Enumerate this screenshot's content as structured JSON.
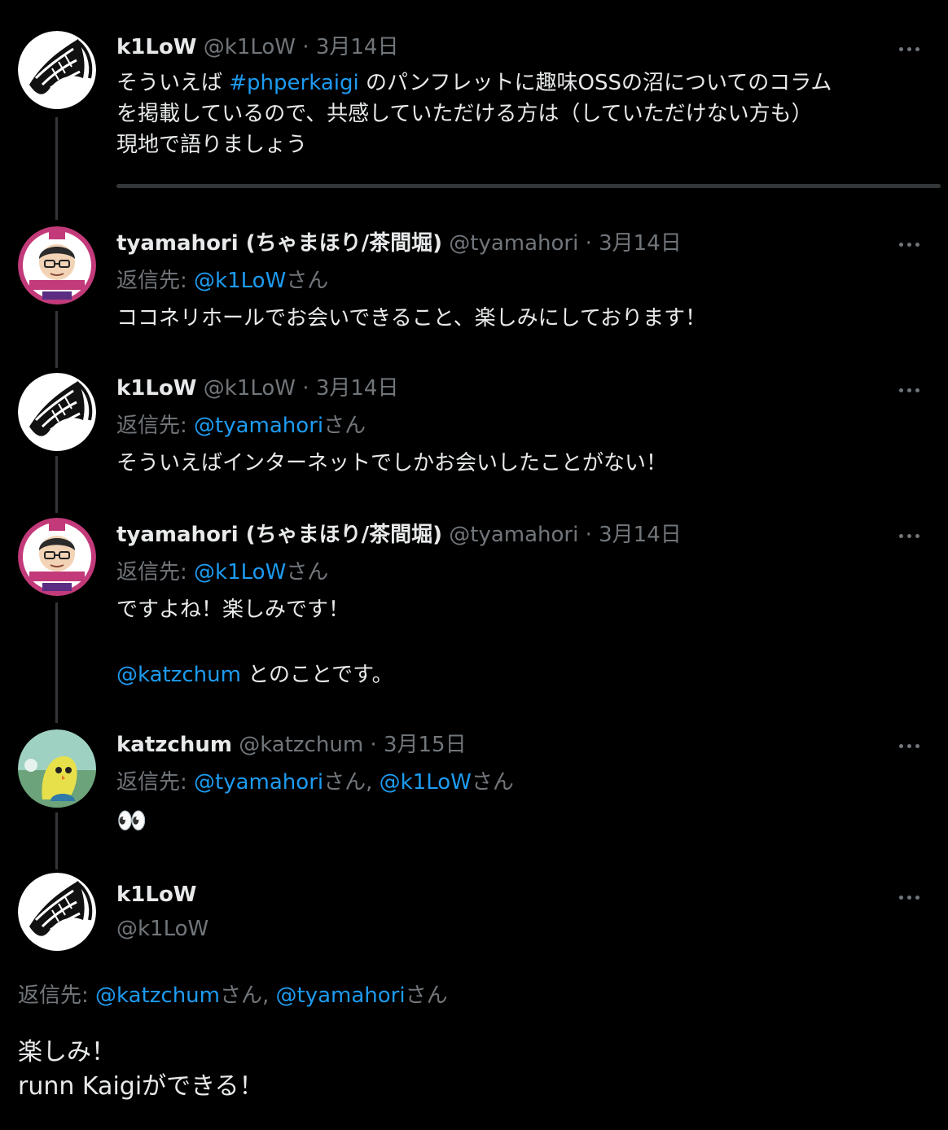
{
  "tweets": [
    {
      "name": "k1LoW",
      "handle": "@k1LoW",
      "sep": "·",
      "date": "3月14日",
      "text_pre": "そういえば ",
      "hashtag": "#phperkaigi",
      "text_post": " のパンフレットに趣味OSSの沼についてのコラム",
      "line2": "を掲載しているので、共感していただける方は（していただけない方も）",
      "line3": "現地で語りましょう"
    },
    {
      "name": "tyamahori (ちゃまほり/茶間堀)",
      "handle": "@tyamahori",
      "sep": "·",
      "date": "3月14日",
      "reply_label": "返信先: ",
      "reply_to": "@k1LoW",
      "reply_suffix": "さん",
      "text": "ココネリホールでお会いできること、楽しみにしております！"
    },
    {
      "name": "k1LoW",
      "handle": "@k1LoW",
      "sep": "·",
      "date": "3月14日",
      "reply_label": "返信先: ",
      "reply_to": "@tyamahori",
      "reply_suffix": "さん",
      "text": "そういえばインターネットでしかお会いしたことがない！"
    },
    {
      "name": "tyamahori (ちゃまほり/茶間堀)",
      "handle": "@tyamahori",
      "sep": "·",
      "date": "3月14日",
      "reply_label": "返信先: ",
      "reply_to": "@k1LoW",
      "reply_suffix": "さん",
      "text": "ですよね！楽しみです！",
      "mention": "@katzchum",
      "mention_post": " とのことです。"
    },
    {
      "name": "katzchum",
      "handle": "@katzchum",
      "sep": "·",
      "date": "3月15日",
      "reply_label": "返信先: ",
      "reply_to_1": "@tyamahori",
      "reply_mid": "さん, ",
      "reply_to_2": "@k1LoW",
      "reply_suffix": "さん",
      "text": "👀"
    }
  ],
  "focused": {
    "name": "k1LoW",
    "handle": "@k1LoW",
    "reply_label": "返信先: ",
    "reply_to_1": "@katzchum",
    "reply_mid": "さん, ",
    "reply_to_2": "@tyamahori",
    "reply_suffix": "さん",
    "line1": "楽しみ！",
    "line2": "runn Kaigiができる！"
  },
  "colors": {
    "link": "#1d9bf0",
    "muted": "#71767b",
    "background": "#000000"
  },
  "icons": {
    "more": "more-horizontal-icon"
  }
}
